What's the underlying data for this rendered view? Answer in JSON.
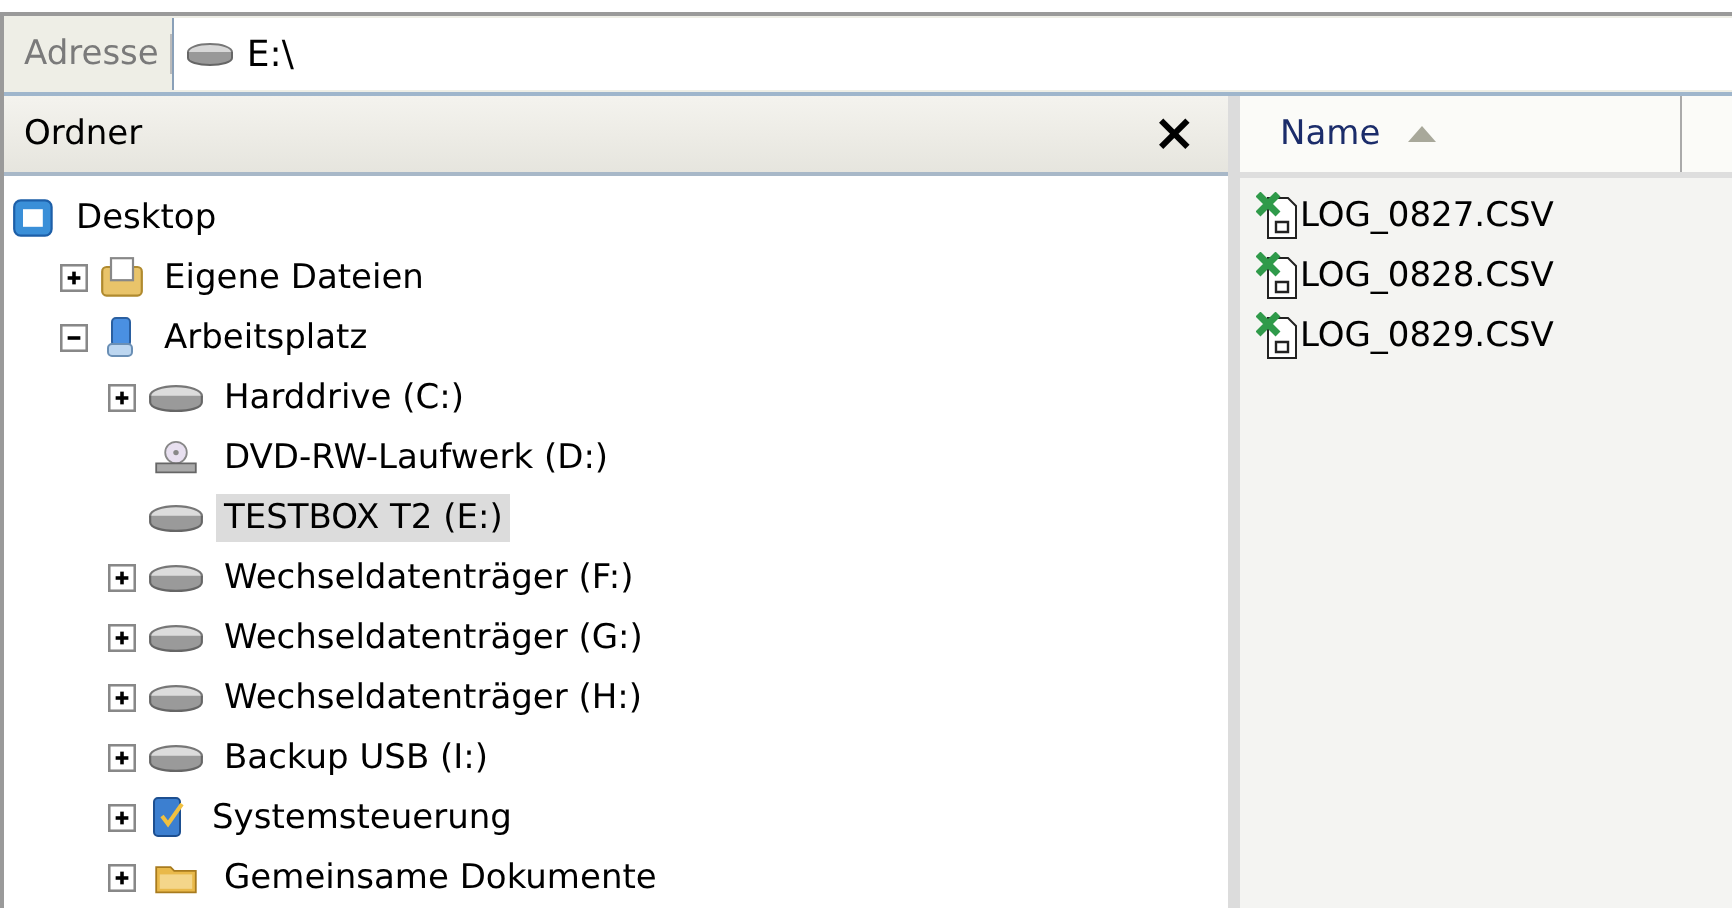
{
  "address_bar": {
    "label": "Adresse",
    "value": "E:\\"
  },
  "folders_pane": {
    "title": "Ordner",
    "close": "×",
    "tree": [
      {
        "label": "Desktop",
        "kind": "desktop",
        "selected": false,
        "children": [
          {
            "label": "Eigene Dateien",
            "kind": "documents",
            "expanded": false,
            "selected": false
          },
          {
            "label": "Arbeitsplatz",
            "kind": "computer",
            "expanded": true,
            "selected": false,
            "children": [
              {
                "label": "Harddrive (C:)",
                "kind": "drive",
                "expanded": false,
                "selected": false
              },
              {
                "label": "DVD-RW-Laufwerk (D:)",
                "kind": "dvd",
                "selected": false
              },
              {
                "label": "TESTBOX T2 (E:)",
                "kind": "drive",
                "selected": true
              },
              {
                "label": "Wechseldatenträger (F:)",
                "kind": "drive",
                "expanded": false,
                "selected": false
              },
              {
                "label": "Wechseldatenträger (G:)",
                "kind": "drive",
                "expanded": false,
                "selected": false
              },
              {
                "label": "Wechseldatenträger (H:)",
                "kind": "drive",
                "expanded": false,
                "selected": false
              },
              {
                "label": "Backup USB (I:)",
                "kind": "drive",
                "expanded": false,
                "selected": false
              },
              {
                "label": "Systemsteuerung",
                "kind": "control",
                "expanded": false,
                "selected": false
              },
              {
                "label": "Gemeinsame Dokumente",
                "kind": "folder",
                "expanded": false,
                "selected": false
              }
            ]
          }
        ]
      }
    ]
  },
  "file_list": {
    "columns": [
      {
        "label": "Name",
        "sorted": true
      }
    ],
    "files": [
      {
        "name": "LOG_0827.CSV"
      },
      {
        "name": "LOG_0828.CSV"
      },
      {
        "name": "LOG_0829.CSV"
      }
    ]
  }
}
